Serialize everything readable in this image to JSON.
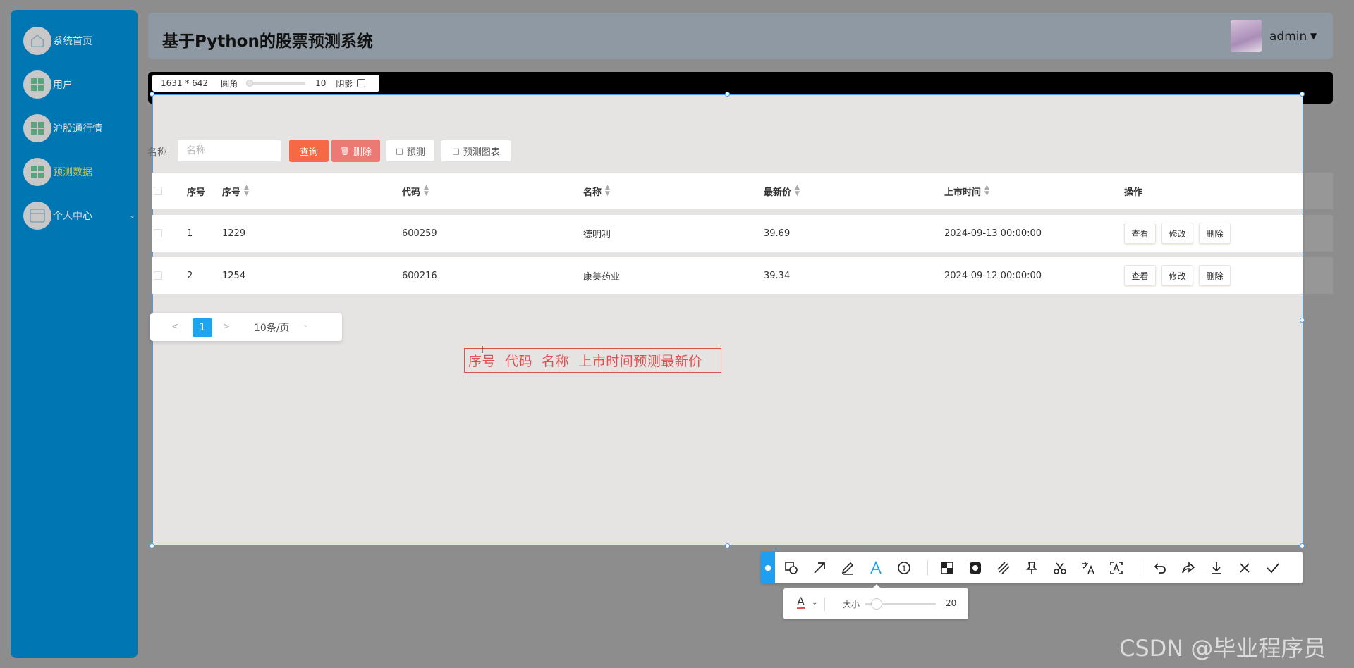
{
  "sidebar": {
    "items": [
      {
        "label": "系统首页",
        "icon": "home-icon"
      },
      {
        "label": "用户",
        "icon": "grid-icon"
      },
      {
        "label": "沪股通行情",
        "icon": "grid-icon"
      },
      {
        "label": "预测数据",
        "icon": "grid-icon",
        "active": true
      },
      {
        "label": "个人中心",
        "icon": "window-icon",
        "has_submenu": true
      }
    ]
  },
  "header": {
    "title": "基于Python的股票预测系统",
    "user": "admin"
  },
  "capture": {
    "size_text": "1631 * 642",
    "radius_label": "圆角",
    "radius_value": "10",
    "shadow_label": "阴影"
  },
  "search": {
    "label": "名称",
    "placeholder": "名称",
    "query_label": "查询",
    "delete_label": "删除",
    "predict_label": "预测",
    "chart_label": "预测图表"
  },
  "table": {
    "headers": [
      "序号",
      "序号",
      "代码",
      "名称",
      "最新价",
      "上市时间",
      "操作"
    ],
    "rows": [
      {
        "index": "1",
        "seq": "1229",
        "code": "600259",
        "name": "德明利",
        "price": "39.69",
        "listed": "2024-09-13 00:00:00"
      },
      {
        "index": "2",
        "seq": "1254",
        "code": "600216",
        "name": "康美药业",
        "price": "39.34",
        "listed": "2024-09-12 00:00:00"
      }
    ],
    "actions": [
      "查看",
      "修改",
      "删除"
    ]
  },
  "pagination": {
    "prev": "<",
    "current": "1",
    "next": ">",
    "page_size": "10条/页"
  },
  "annotation": {
    "text": "序号  代码  名称  上市时间预测最新价"
  },
  "toolbar": {
    "tools": [
      "shape-icon",
      "arrow-icon",
      "pencil-icon",
      "text-icon",
      "number-icon",
      "mosaic-icon",
      "blur-icon",
      "hatch-icon",
      "pin-icon",
      "scissors-icon",
      "translate-icon",
      "ocr-icon",
      "undo-icon",
      "redo-icon",
      "download-icon",
      "close-icon",
      "confirm-icon"
    ],
    "active_tool": "text-icon",
    "accent_color": "#1e9ff2"
  },
  "size_panel": {
    "label": "大小",
    "value": "20",
    "color": "#d9534f"
  },
  "watermark": "CSDN @毕业程序员"
}
